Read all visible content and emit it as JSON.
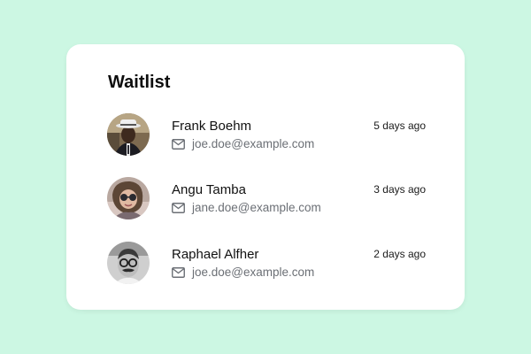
{
  "waitlist": {
    "title": "Waitlist",
    "entries": [
      {
        "name": "Frank Boehm",
        "email": "joe.doe@example.com",
        "time": "5 days ago",
        "avatar_icon": "avatar-man-hat-photo"
      },
      {
        "name": "Angu Tamba",
        "email": "jane.doe@example.com",
        "time": "3 days ago",
        "avatar_icon": "avatar-woman-sunglasses-photo"
      },
      {
        "name": "Raphael Alfher",
        "email": "joe.doe@example.com",
        "time": "2 days ago",
        "avatar_icon": "avatar-man-glasses-bw-photo"
      }
    ],
    "email_icon": "mail-icon"
  },
  "colors": {
    "background": "#ccf7e3",
    "card": "#ffffff",
    "title": "#0d0d0d",
    "email_text": "#6b6f75"
  }
}
